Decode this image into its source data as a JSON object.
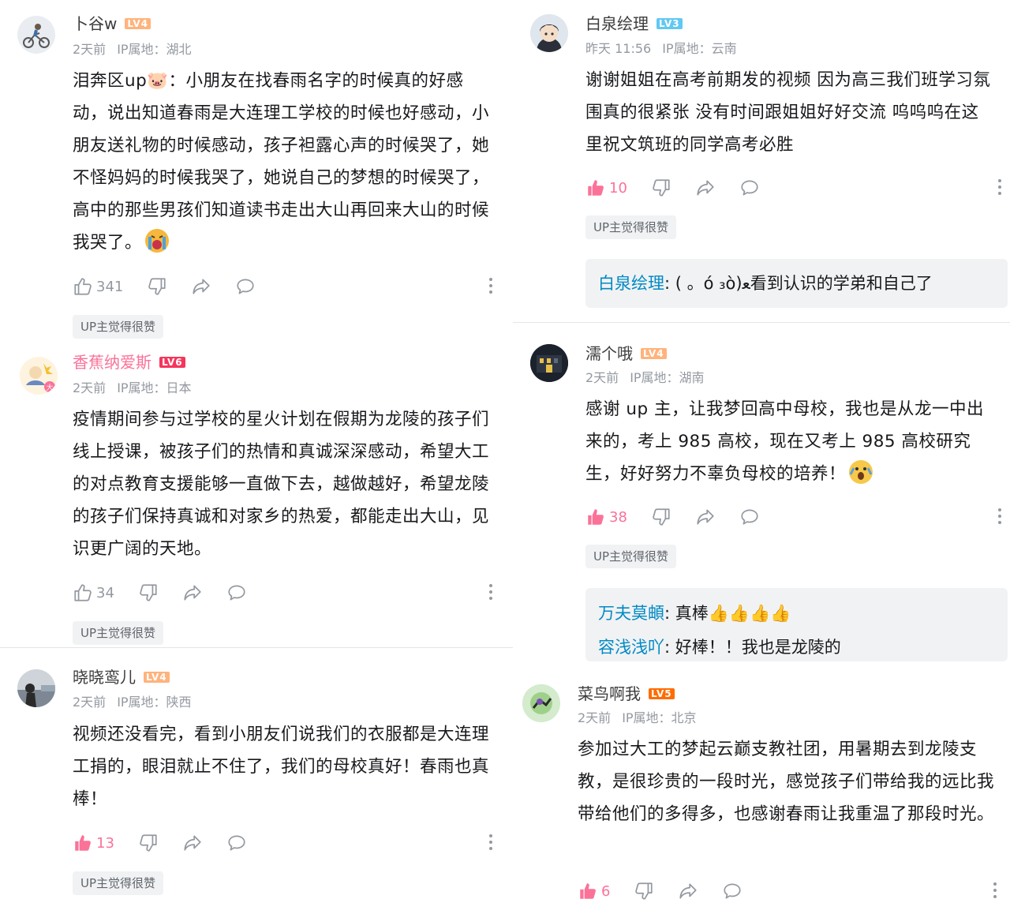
{
  "colors": {
    "accent_pink": "#fb7299",
    "link_blue": "#008ac5",
    "meta_gray": "#9499a0",
    "badge_bg": "#f1f2f3"
  },
  "comments": [
    {
      "username": "卜谷w",
      "level": "LV4",
      "time": "2天前",
      "ip": "IP属地：湖北",
      "text": "泪奔区up🐷：小朋友在找春雨名字的时候真的好感动，说出知道春雨是大连理工学校的时候也好感动，小朋友送礼物的时候感动，孩子袒露心声的时候哭了，她不怪妈妈的时候我哭了，她说自己的梦想的时候哭了，高中的那些男孩们知道读书走出大山再回来大山的时候我哭了。",
      "emoji": "crying-emoji",
      "likes": "341",
      "liked": false,
      "up_badge": "UP主觉得很赞"
    },
    {
      "username": "香蕉纳爱斯",
      "level": "LV6",
      "time": "2天前",
      "ip": "IP属地：日本",
      "text": "疫情期间参与过学校的星火计划在假期为龙陵的孩子们线上授课，被孩子们的热情和真诚深深感动，希望大工的对点教育支援能够一直做下去，越做越好，希望龙陵的孩子们保持真诚和对家乡的热爱，都能走出大山，见识更广阔的天地。",
      "likes": "34",
      "liked": false,
      "up_badge": "UP主觉得很赞"
    },
    {
      "username": "晓晓鸾儿",
      "level": "LV4",
      "time": "2天前",
      "ip": "IP属地：陕西",
      "text": "视频还没看完，看到小朋友们说我们的衣服都是大连理工捐的，眼泪就止不住了，我们的母校真好！春雨也真棒！",
      "likes": "13",
      "liked": true,
      "up_badge": "UP主觉得很赞"
    },
    {
      "username": "白泉绘理",
      "level": "LV3",
      "time": "昨天 11:56",
      "ip": "IP属地：云南",
      "text": "谢谢姐姐在高考前期发的视频 因为高三我们班学习氛围真的很紧张 没有时间跟姐姐好好交流 呜呜呜在这里祝文筑班的同学高考必胜",
      "likes": "10",
      "liked": true,
      "up_badge": "UP主觉得很赞",
      "replies": [
        {
          "name": "白泉绘理",
          "text": ":  ( 。ό ₃ὸ)ﻌ看到认识的学弟和自己了"
        }
      ]
    },
    {
      "username": "濡个哦",
      "level": "LV4",
      "time": "2天前",
      "ip": "IP属地：湖南",
      "text": "感谢 up 主，让我梦回高中母校，我也是从龙一中出来的，考上 985 高校，现在又考上 985 高校研究生，好好努力不辜负母校的培养！",
      "emoji": "surprised-emoji",
      "likes": "38",
      "liked": true,
      "up_badge": "UP主觉得很赞",
      "replies": [
        {
          "name": "万夫莫頔",
          "text": ": 真棒👍👍👍👍"
        },
        {
          "name": "容浅浅吖",
          "text": ": 好棒！！我也是龙陵的"
        }
      ]
    },
    {
      "username": "菜鸟啊我",
      "level": "LV5",
      "time": "2天前",
      "ip": "IP属地：北京",
      "text": "参加过大工的梦起云巅支教社团，用暑期去到龙陵支教，是很珍贵的一段时光，感觉孩子们带给我的远比我带给他们的多得多，也感谢春雨让我重温了那段时光。",
      "likes": "6",
      "liked": true
    }
  ]
}
